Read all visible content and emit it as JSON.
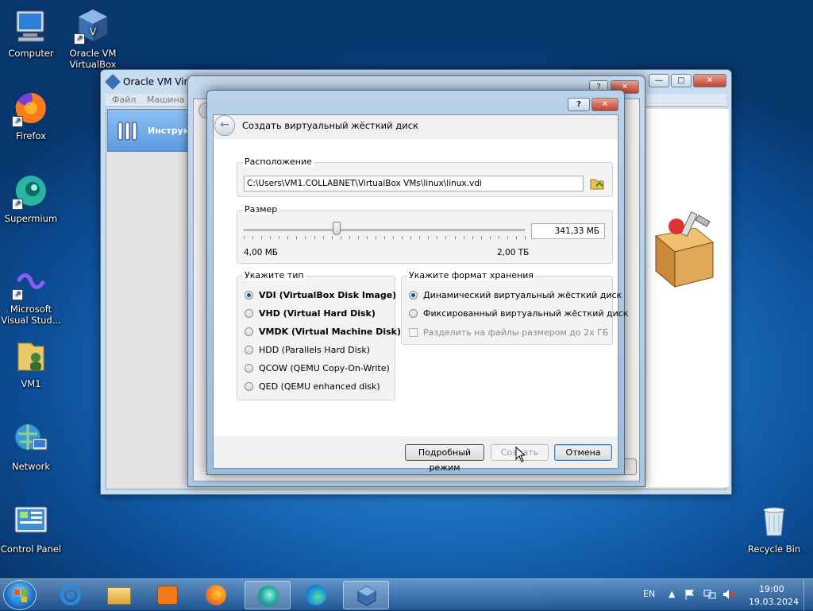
{
  "desktop": {
    "icons": [
      {
        "label": "Computer"
      },
      {
        "label": "Oracle VM VirtualBox"
      },
      {
        "label": "Firefox"
      },
      {
        "label": "Supermium"
      },
      {
        "label": "Microsoft Visual Stud..."
      },
      {
        "label": "VM1"
      },
      {
        "label": "Network"
      },
      {
        "label": "Control Panel"
      },
      {
        "label": "Recycle Bin"
      }
    ]
  },
  "main_window": {
    "title": "Oracle VM Virtu",
    "menu": [
      "Файл",
      "Машина"
    ],
    "tools_label": "Инструм"
  },
  "dialog": {
    "title": "Создать виртуальный жёсткий диск",
    "help_btn": "?",
    "close_btn": "✕",
    "location": {
      "label": "Расположение",
      "path": "C:\\Users\\VM1.COLLABNET\\VirtualBox VMs\\linux\\linux.vdi"
    },
    "size": {
      "label": "Размер",
      "value": "341,33 МБ",
      "min_label": "4,00 МБ",
      "max_label": "2,00 ТБ",
      "slider_fraction": 0.33
    },
    "type": {
      "label": "Укажите тип",
      "options": [
        {
          "label": "VDI (VirtualBox Disk Image)",
          "selected": true,
          "bold": true
        },
        {
          "label": "VHD (Virtual Hard Disk)",
          "selected": false,
          "bold": true
        },
        {
          "label": "VMDK (Virtual Machine Disk)",
          "selected": false,
          "bold": true
        },
        {
          "label": "HDD (Parallels Hard Disk)",
          "selected": false,
          "bold": false
        },
        {
          "label": "QCOW (QEMU Copy-On-Write)",
          "selected": false,
          "bold": false
        },
        {
          "label": "QED (QEMU enhanced disk)",
          "selected": false,
          "bold": false
        }
      ]
    },
    "format": {
      "label": "Укажите формат хранения",
      "options": [
        {
          "label": "Динамический виртуальный жёсткий диск",
          "selected": true
        },
        {
          "label": "Фиксированный виртуальный жёсткий диск",
          "selected": false
        }
      ],
      "split_label": "Разделить на файлы размером до 2х ГБ"
    },
    "buttons": {
      "expert": "Подробный режим",
      "create": "Создать",
      "cancel": "Отмена"
    }
  },
  "taskbar": {
    "lang": "EN",
    "time": "19:00",
    "date": "19.03.2024"
  }
}
